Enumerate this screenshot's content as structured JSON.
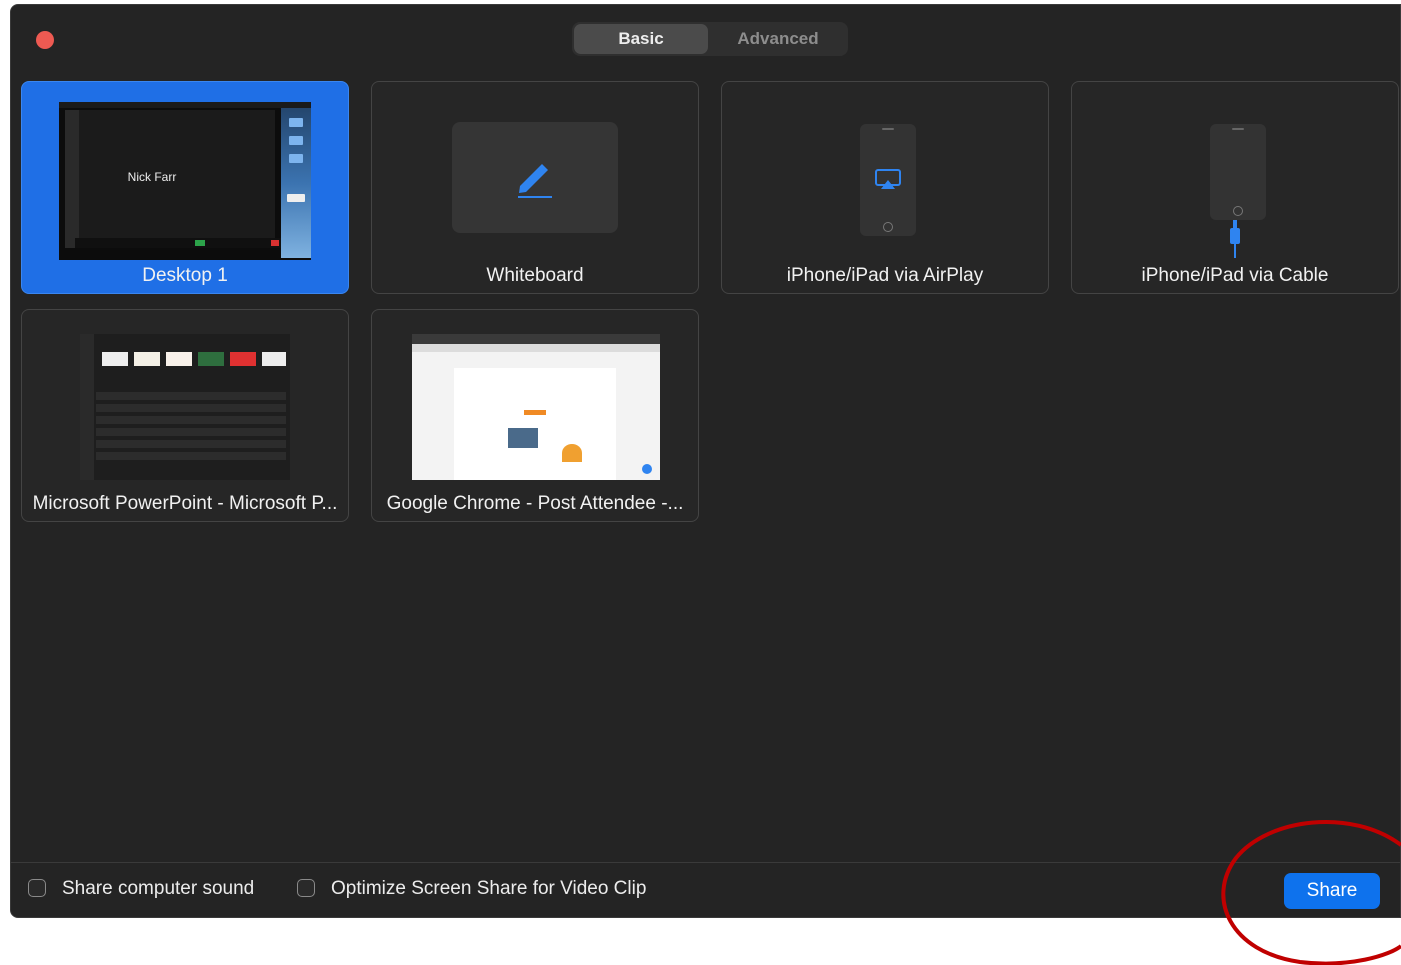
{
  "tabs": {
    "basic": "Basic",
    "advanced": "Advanced"
  },
  "tiles": [
    {
      "label": "Desktop 1",
      "selected": true,
      "preview_text": "Nick Farr"
    },
    {
      "label": "Whiteboard",
      "selected": false
    },
    {
      "label": "iPhone/iPad via AirPlay",
      "selected": false
    },
    {
      "label": "iPhone/iPad via Cable",
      "selected": false
    },
    {
      "label": "Microsoft PowerPoint - Microsoft P...",
      "selected": false
    },
    {
      "label": "Google Chrome - Post Attendee -...",
      "selected": false
    }
  ],
  "options": {
    "share_sound": {
      "label": "Share computer sound",
      "checked": false
    },
    "optimize_video": {
      "label": "Optimize Screen Share for Video Clip",
      "checked": false
    }
  },
  "share_button": "Share",
  "colors": {
    "accent": "#0e72ed",
    "selected_tile": "#1f6fe6",
    "annotation": "#c00000"
  },
  "icons": {
    "close": "red-traffic-light",
    "whiteboard": "pencil-icon",
    "airplay": "airplay-icon",
    "cable": "lightning-cable-icon"
  }
}
